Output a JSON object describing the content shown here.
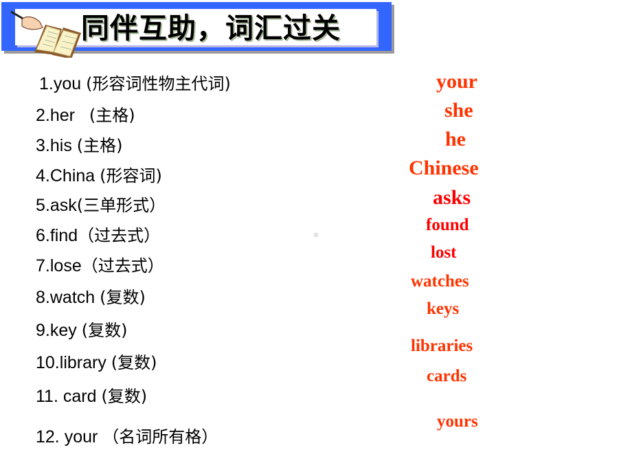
{
  "header": {
    "title": "同伴互助，词汇过关",
    "icon": "book-with-writing-hand-icon",
    "colors": {
      "banner": "#3366ff",
      "panel": "#ffffff",
      "title": "#000000"
    }
  },
  "questions": [
    {
      "num": "1.",
      "word": "you ",
      "hint": "(形容词性物主代词)"
    },
    {
      "num": "2.",
      "word": "her   ",
      "hint": "(主格)"
    },
    {
      "num": "3.",
      "word": "his ",
      "hint": "(主格)"
    },
    {
      "num": "4.",
      "word": "China ",
      "hint": "(形容词)"
    },
    {
      "num": "5.",
      "word": "ask",
      "hint": "(三单形式）"
    },
    {
      "num": "6.",
      "word": "find",
      "hint": "（过去式）"
    },
    {
      "num": "7.",
      "word": "lose",
      "hint": "（过去式）"
    },
    {
      "num": "8.",
      "word": "watch ",
      "hint": "(复数)"
    },
    {
      "num": "9.",
      "word": "key ",
      "hint": "(复数)"
    },
    {
      "num": "10.",
      "word": "library ",
      "hint": "(复数)"
    },
    {
      "num": "11. ",
      "word": "card ",
      "hint": "(复数)"
    },
    {
      "num": "12. ",
      "word": "your ",
      "hint": "（名词所有格）"
    }
  ],
  "answers": [
    {
      "text": "your",
      "color": "#ff3300"
    },
    {
      "text": "she",
      "color": "#ff3300"
    },
    {
      "text": "he",
      "color": "#ff3300"
    },
    {
      "text": "Chinese",
      "color": "#ff3300"
    },
    {
      "text": "asks",
      "color": "#ff0000"
    },
    {
      "text": "found",
      "color": "#ff0000"
    },
    {
      "text": "lost",
      "color": "#ff0000"
    },
    {
      "text": "watches",
      "color": "#ff3300"
    },
    {
      "text": "keys",
      "color": "#ff3300"
    },
    {
      "text": "libraries",
      "color": "#ff3300"
    },
    {
      "text": "cards",
      "color": "#ff3300"
    },
    {
      "text": "yours",
      "color": "#ff3300"
    }
  ]
}
